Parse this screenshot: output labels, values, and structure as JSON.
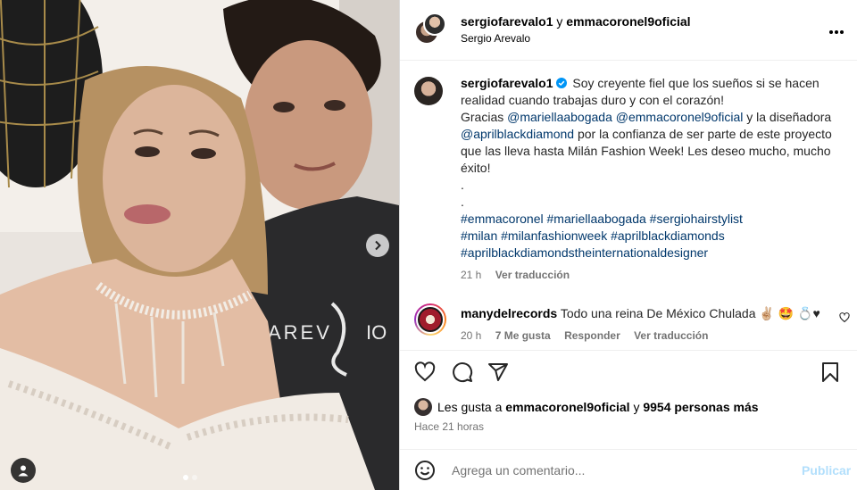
{
  "header": {
    "user1": "sergiofarevalo1",
    "connector": "y",
    "user2": "emmacoronel9oficial",
    "subtitle": "Sergio Arevalo",
    "more_icon": "more-horizontal-icon"
  },
  "caption": {
    "username": "sergiofarevalo1",
    "text_1": "Soy creyente fiel que los sueños si se hacen realidad cuando trabajas duro y con el corazón!",
    "gracias": "Gracias",
    "mention_1": "@mariellaabogada",
    "mention_2": "@emmacoronel9oficial",
    "y_la": "y la diseñadora",
    "mention_3": "@aprilblackdiamond",
    "text_2": "por la confianza de ser parte de este proyecto que las lleva hasta Milán Fashion Week! Les deseo mucho, mucho éxito!",
    "dot": ".",
    "hashtags_1": "#emmacoronel #mariellaabogada #sergiohairstylist",
    "hashtags_2": "#milan #milanfashionweek #aprilblackdiamonds",
    "hashtags_3": "#aprilblackdiamondstheinternationaldesigner",
    "time": "21 h",
    "translate": "Ver traducción"
  },
  "comment": {
    "username": "manydelrecords",
    "text": "Todo una reina De México Chulada ✌🏼 🤩 💍♥",
    "time": "20 h",
    "likes": "7 Me gusta",
    "reply": "Responder",
    "translate": "Ver traducción"
  },
  "likes": {
    "prefix": "Les gusta a",
    "user": "emmacoronel9oficial",
    "connector": "y",
    "others": "9954 personas más"
  },
  "timestamp": "Hace 21 horas",
  "add_comment": {
    "placeholder": "Agrega un comentario...",
    "publish": "Publicar"
  },
  "carousel": {
    "slides": 2,
    "active": 1
  },
  "colors": {
    "link": "#00376b",
    "muted": "#737373",
    "publish_disabled": "#b2dffc"
  }
}
